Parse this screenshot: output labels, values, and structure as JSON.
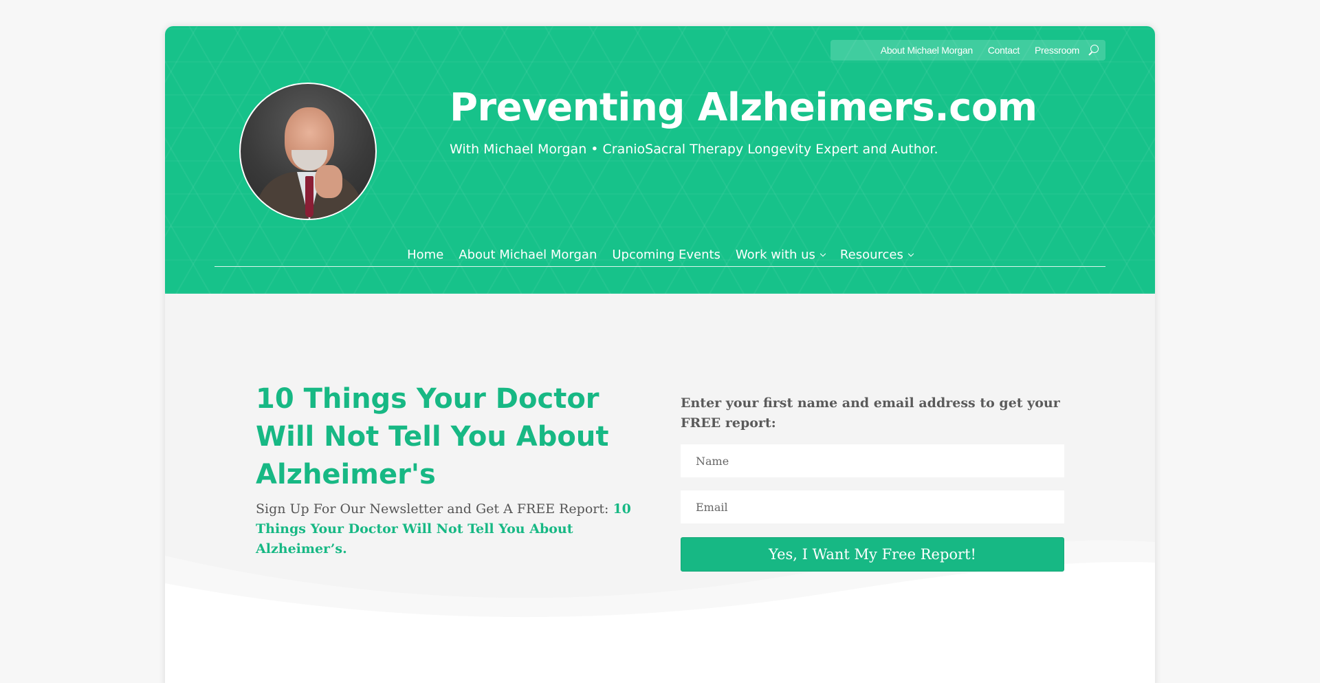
{
  "topbar": {
    "links": [
      "About Michael Morgan",
      "Contact",
      "Pressroom"
    ]
  },
  "header": {
    "title": "Preventing Alzheimers.com",
    "subtitle": "With Michael Morgan • CranioSacral Therapy Longevity Expert and Author."
  },
  "nav": {
    "items": [
      {
        "label": "Home"
      },
      {
        "label": "About Michael Morgan"
      },
      {
        "label": "Upcoming Events"
      },
      {
        "label": "Work with us"
      },
      {
        "label": "Resources"
      }
    ]
  },
  "hero": {
    "headline": "10 Things Your Doctor Will Not Tell You About Alzheimer's",
    "lead_text": "Sign Up For Our Newsletter and Get A FREE Report: ",
    "lead_highlight": "10 Things Your Doctor Will Not Tell You About Alzheimer’s."
  },
  "form": {
    "label": "Enter your first name and email address to get your FREE report:",
    "name_placeholder": "Name",
    "email_placeholder": "Email",
    "submit_label": "Yes, I Want My Free Report!"
  },
  "colors": {
    "brand_green": "#17c28a",
    "accent_green": "#17b884"
  }
}
